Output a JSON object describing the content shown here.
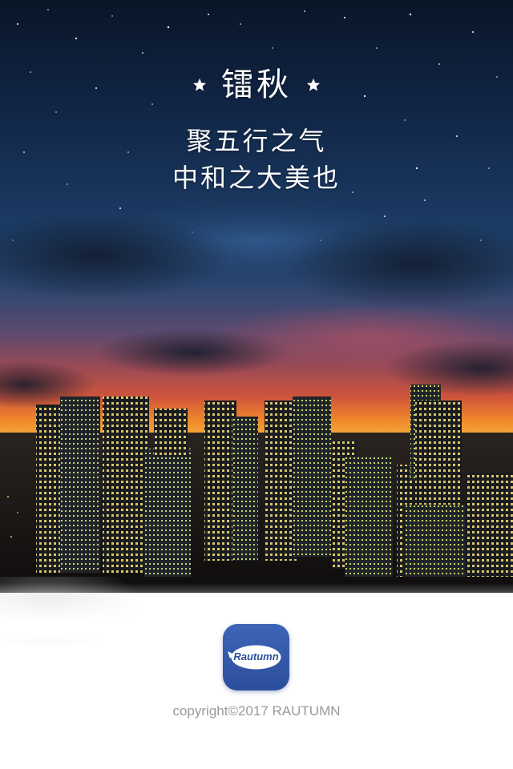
{
  "splash": {
    "title": "镭秋",
    "slogan_line1": "聚五行之气",
    "slogan_line2": "中和之大美也",
    "title_decoration_icon": "star-icon"
  },
  "app_icon": {
    "label": "Rautumn",
    "icon": "rautumn-logo-icon"
  },
  "footer": {
    "copyright": "copyright©2017 RAUTUMN"
  },
  "colors": {
    "brand_blue": "#2c4f9c",
    "copyright_gray": "#9a9a9a",
    "title_white": "#ffffff"
  }
}
